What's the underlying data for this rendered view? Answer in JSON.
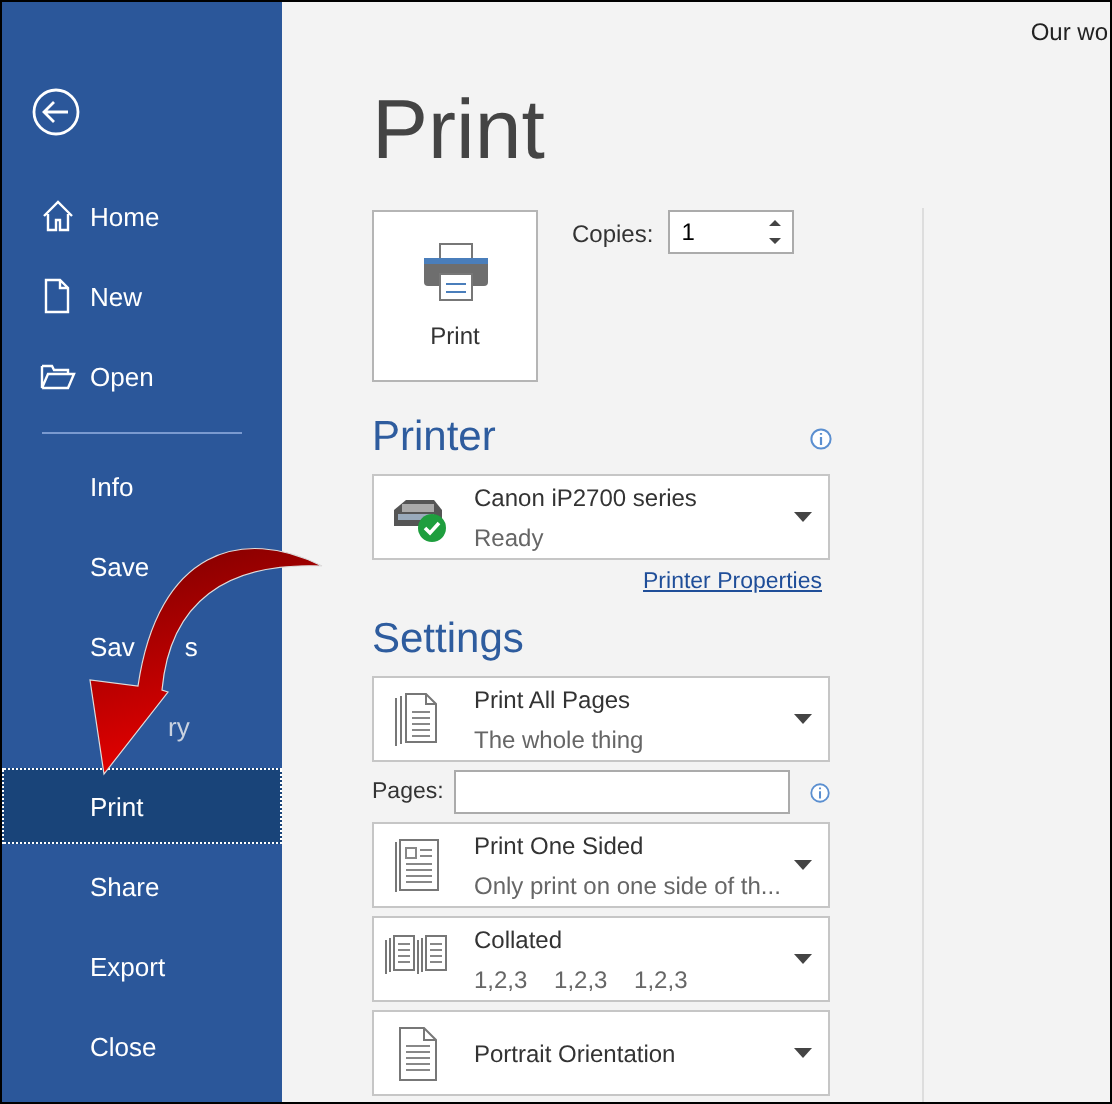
{
  "sidebar": {
    "primary": [
      {
        "label_parts": [
          "Home"
        ],
        "selected": false
      },
      {
        "label_parts": [
          "New"
        ],
        "selected": false
      },
      {
        "label_parts": [
          "Open"
        ],
        "selected": false
      }
    ],
    "secondary": [
      {
        "label_parts": [
          "Info"
        ],
        "selected": false
      },
      {
        "label_parts": [
          "Save"
        ],
        "selected": false
      },
      {
        "label_parts": [
          "Sav",
          "s"
        ],
        "selected": false
      },
      {
        "label_parts": [
          "ry"
        ],
        "covered_start": true,
        "selected": false
      },
      {
        "label_parts": [
          "Print"
        ],
        "selected": true
      },
      {
        "label_parts": [
          "Share"
        ],
        "selected": false
      },
      {
        "label_parts": [
          "Export"
        ],
        "selected": false
      },
      {
        "label_parts": [
          "Close"
        ],
        "selected": false
      }
    ]
  },
  "main": {
    "title": "Print",
    "print_button": {
      "label": "Print"
    },
    "copies": {
      "label": "Copies:",
      "value": "1"
    },
    "printer": {
      "heading": "Printer",
      "name": "Canon iP2700 series",
      "status": "Ready",
      "properties_link": "Printer Properties"
    },
    "settings": {
      "heading": "Settings",
      "options": [
        {
          "kind": "pages",
          "title": "Print All Pages",
          "subtitle": "The whole thing"
        },
        {
          "kind": "field",
          "label": "Pages:"
        },
        {
          "kind": "sides",
          "title": "Print One Sided",
          "subtitle": "Only print on one side of th..."
        },
        {
          "kind": "collation",
          "title": "Collated",
          "subtitle": "1,2,3    1,2,3    1,2,3"
        },
        {
          "kind": "orientation",
          "title": "Portrait Orientation"
        }
      ]
    }
  },
  "preview": {
    "text": "Our wo"
  }
}
